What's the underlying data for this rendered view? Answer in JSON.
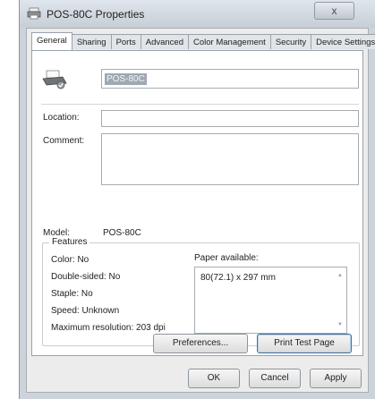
{
  "window": {
    "title": "POS-80C Properties",
    "close_label": "x"
  },
  "tabs": [
    {
      "label": "General"
    },
    {
      "label": "Sharing"
    },
    {
      "label": "Ports"
    },
    {
      "label": "Advanced"
    },
    {
      "label": "Color Management"
    },
    {
      "label": "Security"
    },
    {
      "label": "Device Settings"
    }
  ],
  "general": {
    "printer_name": "POS-80C",
    "location_label": "Location:",
    "location_value": "",
    "comment_label": "Comment:",
    "comment_value": "",
    "model_label": "Model:",
    "model_value": "POS-80C",
    "features": {
      "title": "Features",
      "color": "Color: No",
      "double_sided": "Double-sided: No",
      "staple": "Staple: No",
      "speed": "Speed: Unknown",
      "max_resolution": "Maximum resolution: 203 dpi",
      "paper_label": "Paper available:",
      "paper_items": [
        "80(72.1) x 297 mm"
      ]
    },
    "preferences_button": "Preferences...",
    "print_test_button": "Print Test Page"
  },
  "footer": {
    "ok": "OK",
    "cancel": "Cancel",
    "apply": "Apply"
  }
}
